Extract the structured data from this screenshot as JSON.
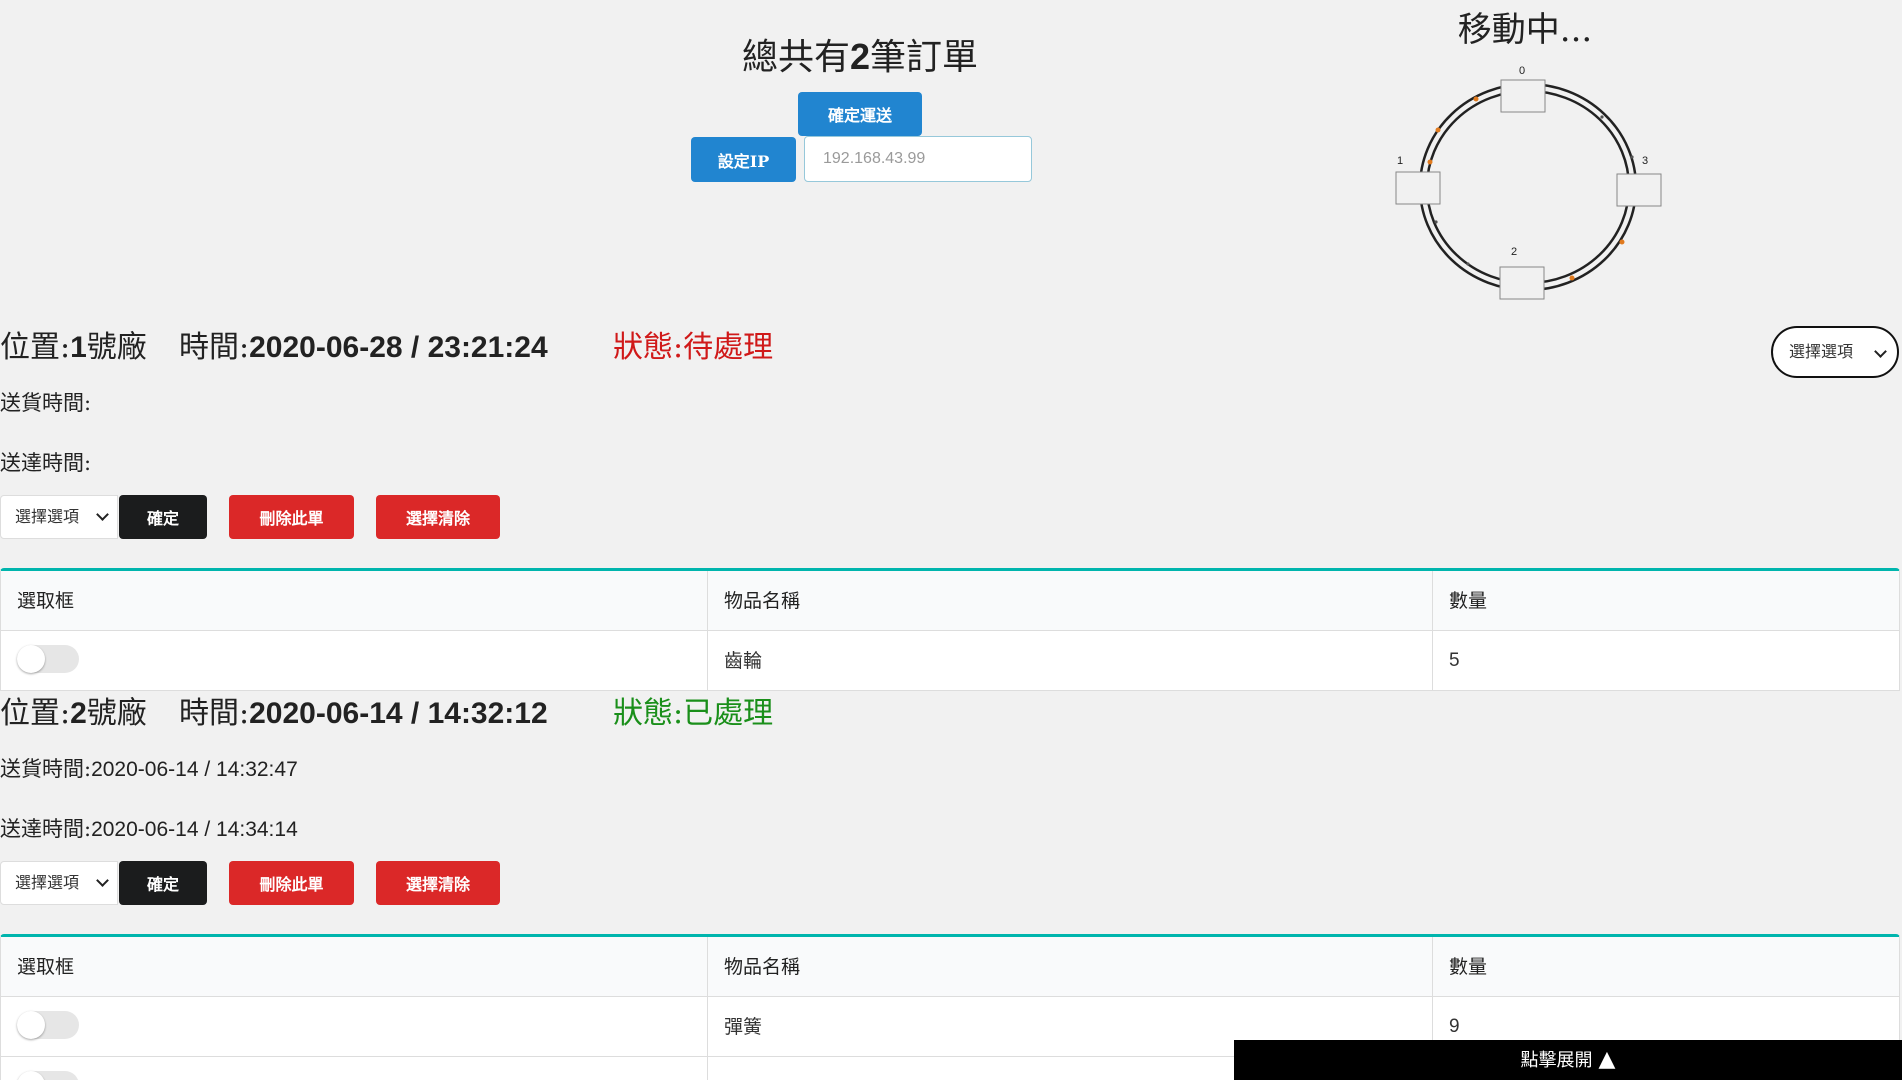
{
  "header": {
    "order_count_prefix": "總共有",
    "order_count_number": "2",
    "order_count_suffix": "筆訂單",
    "confirm_ship_label": "確定運送",
    "set_ip_label": "設定IP",
    "ip_placeholder": "192.168.43.99",
    "moving_status": "移動中...",
    "top_select_value": "選擇選項"
  },
  "track": {
    "station_labels": [
      "0",
      "1",
      "2",
      "3"
    ]
  },
  "orders": [
    {
      "location_label": "位置:",
      "location_number": "1",
      "location_suffix": "號廠",
      "time_label": "時間:",
      "time_value": "2020-06-28 / 23:21:24",
      "status": "狀態:待處理",
      "status_color": "#d01919",
      "ship_time_label": "送貨時間:",
      "ship_time_value": "",
      "arrive_time_label": "送達時間:",
      "arrive_time_value": "",
      "select_value": "選擇選項",
      "confirm_label": "確定",
      "delete_label": "刪除此單",
      "clear_label": "選擇清除",
      "table": {
        "headers": [
          "選取框",
          "物品名稱",
          "數量"
        ],
        "rows": [
          {
            "item": "齒輪",
            "qty": "5"
          }
        ]
      }
    },
    {
      "location_label": "位置:",
      "location_number": "2",
      "location_suffix": "號廠",
      "time_label": "時間:",
      "time_value": "2020-06-14 / 14:32:12",
      "status": "狀態:已處理",
      "status_color": "#1a8f1a",
      "ship_time_label": "送貨時間:",
      "ship_time_value": "2020-06-14 / 14:32:47",
      "arrive_time_label": "送達時間:",
      "arrive_time_value": "2020-06-14 / 14:34:14",
      "select_value": "選擇選項",
      "confirm_label": "確定",
      "delete_label": "刪除此單",
      "clear_label": "選擇清除",
      "table": {
        "headers": [
          "選取框",
          "物品名稱",
          "數量"
        ],
        "rows": [
          {
            "item": "彈簧",
            "qty": "9"
          }
        ]
      }
    }
  ],
  "footer": {
    "expand_label": "點擊展開",
    "expand_icon": "triangle-up-icon"
  }
}
